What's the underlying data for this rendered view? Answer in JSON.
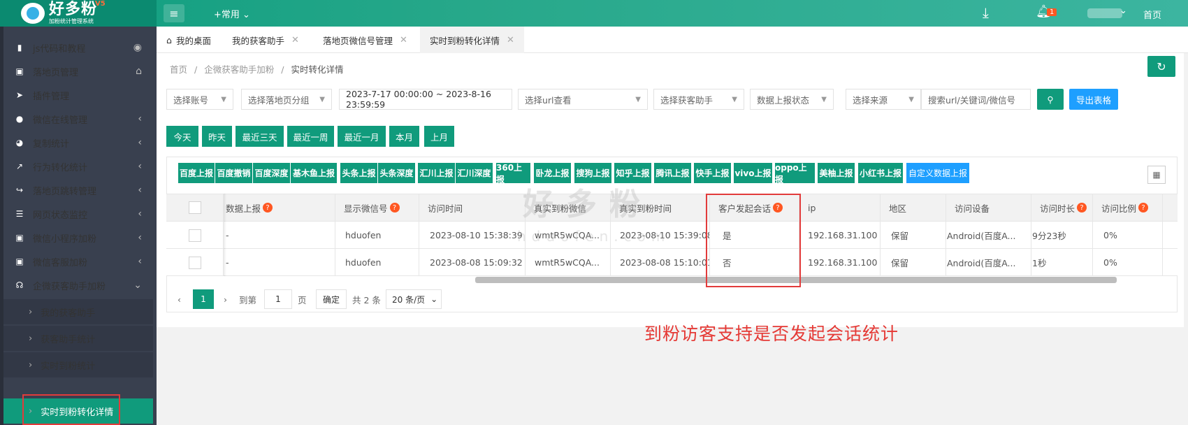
{
  "header": {
    "logo_title": "好多粉",
    "logo_subtitle": "加粉统计管理系统",
    "logo_sup": "V5",
    "common_menu": "+常用",
    "notification_count": "1",
    "home_link": "首页"
  },
  "sidebar": {
    "items": [
      {
        "label": "js代码和教程",
        "icon": "bookmark-icon"
      },
      {
        "label": "落地页管理",
        "icon": "page-icon"
      },
      {
        "label": "插件管理",
        "icon": "send-icon"
      },
      {
        "label": "微信在线管理",
        "icon": "wechat-icon"
      },
      {
        "label": "复制统计",
        "icon": "pie-icon"
      },
      {
        "label": "行为转化统计",
        "icon": "trend-icon"
      },
      {
        "label": "落地页跳转管理",
        "icon": "share-icon"
      },
      {
        "label": "网页状态监控",
        "icon": "server-icon"
      },
      {
        "label": "微信小程序加粉",
        "icon": "miniprogram-icon"
      },
      {
        "label": "微信客服加粉",
        "icon": "service-icon"
      },
      {
        "label": "企微获客助手加粉",
        "icon": "headset-icon"
      }
    ],
    "subitems": [
      {
        "label": "我的获客助手"
      },
      {
        "label": "获客助手统计"
      },
      {
        "label": "实时到粉统计"
      },
      {
        "label": "实时到粉转化详情"
      }
    ]
  },
  "tabs": [
    {
      "label": "我的桌面"
    },
    {
      "label": "我的获客助手"
    },
    {
      "label": "落地页微信号管理"
    },
    {
      "label": "实时到粉转化详情"
    }
  ],
  "breadcrumb": {
    "items": [
      "首页",
      "企微获客助手加粉",
      "实时转化详情"
    ],
    "separator": "/"
  },
  "filters": {
    "account": "选择账号",
    "group": "选择落地页分组",
    "date_range": "2023-7-17 00:00:00 ~ 2023-8-16 23:59:59",
    "url": "选择url查看",
    "assistant": "选择获客助手",
    "report_status": "数据上报状态",
    "source": "选择来源",
    "search_placeholder": "搜索url/关键词/微信号",
    "export": "导出表格"
  },
  "quick_dates": [
    "今天",
    "昨天",
    "最近三天",
    "最近一周",
    "最近一月",
    "本月",
    "上月"
  ],
  "report_buttons": [
    "百度上报",
    "百度撤销",
    "百度深度",
    "基木鱼上报",
    "头条上报",
    "头条深度",
    "汇川上报",
    "汇川深度",
    "360上报",
    "卧龙上报",
    "搜狗上报",
    "知乎上报",
    "腾讯上报",
    "快手上报",
    "vivo上报",
    "oppo上报",
    "美柚上报",
    "小红书上报",
    "自定义数据上报"
  ],
  "table": {
    "columns": [
      "数据上报",
      "显示微信号",
      "访问时间",
      "真实到粉微信",
      "真实到粉时间",
      "客户发起会话",
      "ip",
      "地区",
      "访问设备",
      "访问时长",
      "访问比例"
    ],
    "rows": [
      {
        "report": "-",
        "wechat": "hduofen",
        "visit_time": "2023-08-10 15:38:39",
        "real_wechat": "wmtR5wCQA...",
        "fan_time": "2023-08-10 15:39:08",
        "session": "是",
        "ip": "192.168.31.100",
        "region": "保留",
        "device": "Android(百度A...",
        "duration": "9分23秒",
        "ratio": "0%"
      },
      {
        "report": "-",
        "wechat": "hduofen",
        "visit_time": "2023-08-08 15:09:32",
        "real_wechat": "wmtR5wCQA...",
        "fan_time": "2023-08-08 15:10:01",
        "session": "否",
        "ip": "192.168.31.100",
        "region": "保留",
        "device": "Android(百度A...",
        "duration": "1秒",
        "ratio": "0%"
      }
    ]
  },
  "pagination": {
    "current": "1",
    "goto_label": "到第",
    "goto_value": "1",
    "page_label": "页",
    "confirm": "确定",
    "total": "共 2 条",
    "page_size": "20 条/页"
  },
  "annotation": "到粉访客支持是否发起会话统计",
  "watermark": {
    "title": "好多粉",
    "url": "hduofen.com"
  },
  "colors": {
    "primary": "#109b7c",
    "blue": "#1e9fff",
    "sidebar": "#39404f",
    "highlight": "#e53935"
  }
}
